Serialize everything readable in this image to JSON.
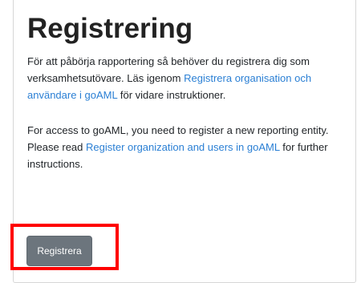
{
  "page": {
    "title": "Registrering"
  },
  "swedish": {
    "text1": "För att påbörja rapportering så behöver du registrera dig som verksamhetsutövare. Läs igenom ",
    "link": "Registrera organisation och användare i goAML",
    "text2": " för vidare instruktioner."
  },
  "english": {
    "text1": "For access to goAML, you need to register a new reporting entity. Please read ",
    "link": "Register organization and users in goAML",
    "text2": " for further instructions."
  },
  "actions": {
    "register_label": "Registrera"
  },
  "colors": {
    "link": "#2a7fd4",
    "button": "#6c757d",
    "highlight": "#ff0000"
  }
}
